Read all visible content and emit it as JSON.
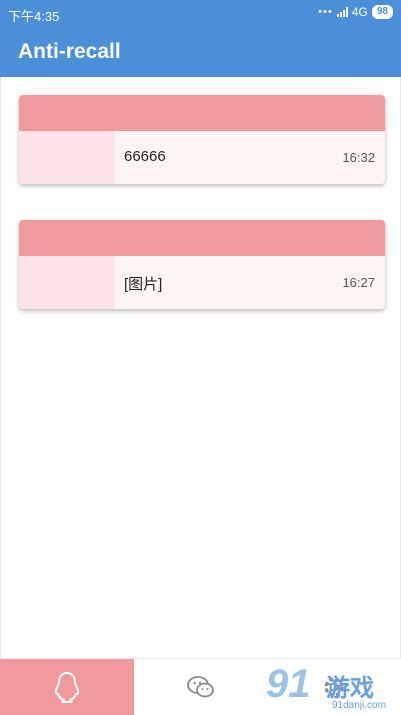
{
  "status_bar": {
    "time": "下午4:35",
    "network": "4G",
    "battery": "98"
  },
  "app_bar": {
    "title": "Anti-recall"
  },
  "messages": [
    {
      "text": "66666",
      "time": "16:32"
    },
    {
      "text": "[图片]",
      "time": "16:27"
    }
  ],
  "bottom_nav": {
    "tabs": [
      {
        "icon": "qq-penguin-icon",
        "active": true
      },
      {
        "icon": "wechat-icon",
        "active": false
      },
      {
        "icon": "settings-icon",
        "active": false
      }
    ]
  },
  "watermark": {
    "logo": "91",
    "text": "游戏",
    "url": "91danji.com"
  },
  "colors": {
    "primary": "#4a8fd8",
    "accent": "#f09a9c",
    "card_bg": "#fff5f5"
  }
}
